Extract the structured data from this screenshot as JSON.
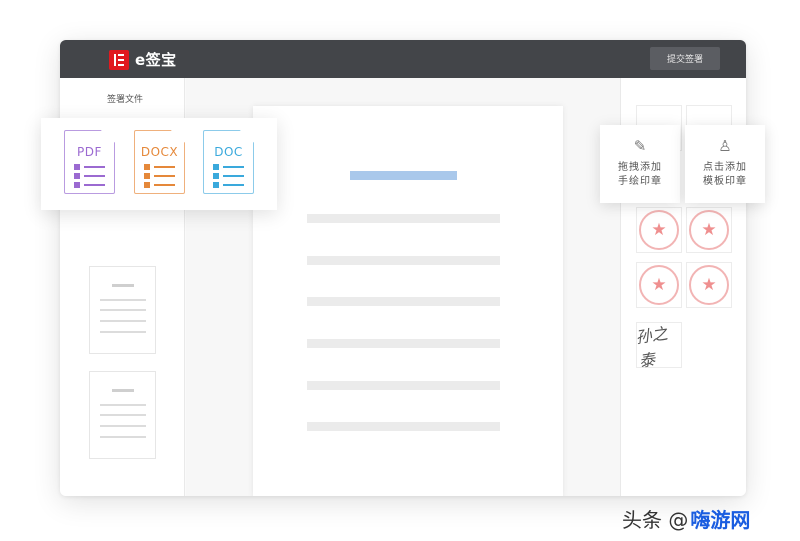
{
  "app": {
    "logo_text": "e签宝",
    "brand_color": "#e0191f",
    "submit_button": "提交签署"
  },
  "left_panel": {
    "title": "签署文件"
  },
  "file_types": [
    {
      "label": "PDF",
      "color": "#9b6ad1"
    },
    {
      "label": "DOCX",
      "color": "#e5883a"
    },
    {
      "label": "DOC",
      "color": "#3aa9dc"
    }
  ],
  "tools": {
    "drag_hand_seal": {
      "line1": "拖拽添加",
      "line2": "手绘印章",
      "icon": "pen-icon"
    },
    "click_template_seal": {
      "line1": "点击添加",
      "line2": "模板印章",
      "icon": "stamp-icon"
    }
  },
  "right_panel": {
    "signature_text": "孙之泰"
  },
  "watermark": {
    "prefix": "头条 @",
    "suffix": "嗨游网"
  }
}
